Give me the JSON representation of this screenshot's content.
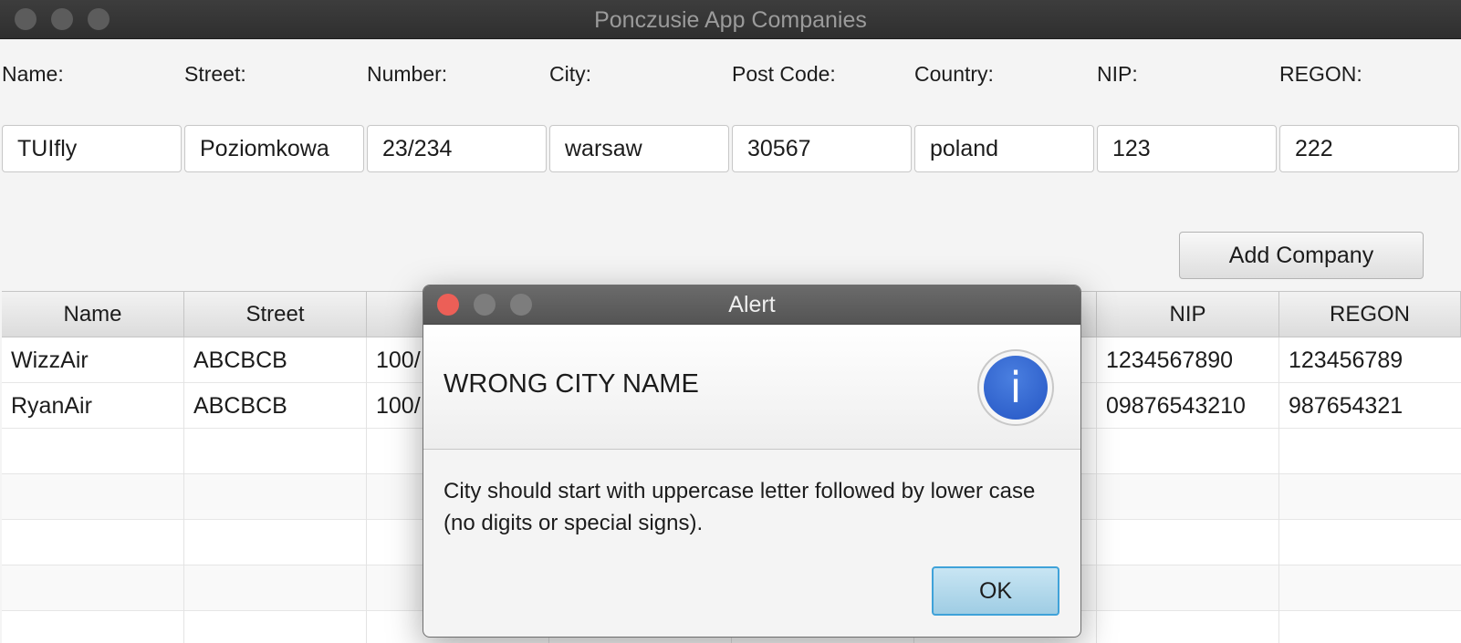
{
  "window": {
    "title": "Ponczusie App Companies"
  },
  "form": {
    "labels": [
      "Name:",
      "Street:",
      "Number:",
      "City:",
      "Post Code:",
      "Country:",
      "NIP:",
      "REGON:"
    ],
    "values": [
      "TUIfly",
      "Poziomkowa",
      "23/234",
      "warsaw",
      "30567",
      "poland",
      "123",
      "222"
    ],
    "add_button": "Add Company"
  },
  "table": {
    "headers": [
      "Name",
      "Street",
      "",
      "",
      "",
      "",
      "NIP",
      "REGON"
    ],
    "rows": [
      [
        "WizzAir",
        "ABCBCB",
        "100/",
        "",
        "",
        "",
        "1234567890",
        "123456789"
      ],
      [
        "RyanAir",
        "ABCBCB",
        "100/",
        "",
        "",
        "",
        "09876543210",
        "987654321"
      ]
    ]
  },
  "dialog": {
    "title": "Alert",
    "header": "WRONG CITY NAME",
    "icon": "info-icon",
    "icon_glyph": "i",
    "content": "City should start with uppercase letter followed by lower case (no digits or special signs).",
    "ok_button": "OK"
  },
  "colors": {
    "titlebar": "#333333",
    "dialog_titlebar": "#5e5e5e",
    "close_red": "#ec5f57",
    "ok_focus": "#3fa2d9",
    "info_blue": "#2f63cf"
  }
}
